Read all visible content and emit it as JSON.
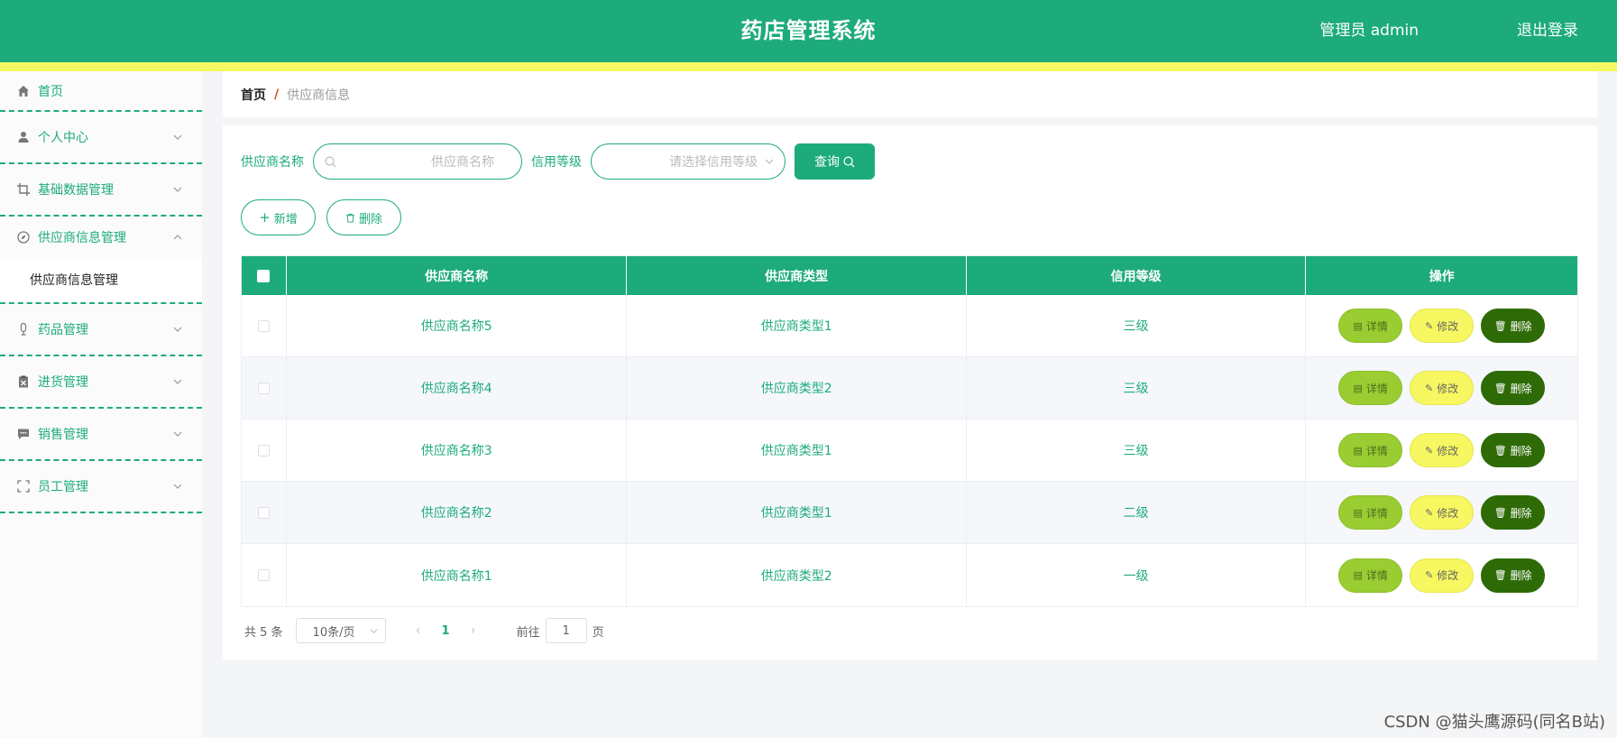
{
  "header": {
    "title": "药店管理系统",
    "user": "管理员 admin",
    "logout": "退出登录"
  },
  "sidebar": {
    "items": [
      {
        "label": "首页",
        "icon": "home-icon"
      },
      {
        "label": "个人中心",
        "icon": "user-icon"
      },
      {
        "label": "基础数据管理",
        "icon": "crop-icon"
      },
      {
        "label": "供应商信息管理",
        "icon": "compass-icon",
        "open": true,
        "children": [
          "供应商信息管理"
        ]
      },
      {
        "label": "药品管理",
        "icon": "microphone-icon"
      },
      {
        "label": "进货管理",
        "icon": "clipboard-icon"
      },
      {
        "label": "销售管理",
        "icon": "message-icon"
      },
      {
        "label": "员工管理",
        "icon": "fullscreen-icon"
      }
    ]
  },
  "breadcrumb": {
    "home": "首页",
    "separator": "/",
    "current": "供应商信息"
  },
  "search": {
    "name_label": "供应商名称",
    "name_placeholder": "供应商名称",
    "level_label": "信用等级",
    "level_placeholder": "请选择信用等级",
    "query_button": "查询"
  },
  "actions": {
    "add": "新增",
    "delete": "删除"
  },
  "table": {
    "headers": [
      "供应商名称",
      "供应商类型",
      "信用等级",
      "操作"
    ],
    "rows": [
      {
        "name": "供应商名称5",
        "type": "供应商类型1",
        "level": "三级"
      },
      {
        "name": "供应商名称4",
        "type": "供应商类型2",
        "level": "三级"
      },
      {
        "name": "供应商名称3",
        "type": "供应商类型1",
        "level": "三级"
      },
      {
        "name": "供应商名称2",
        "type": "供应商类型1",
        "level": "二级"
      },
      {
        "name": "供应商名称1",
        "type": "供应商类型2",
        "level": "一级"
      }
    ],
    "row_actions": {
      "detail": "详情",
      "edit": "修改",
      "delete": "删除"
    }
  },
  "pagination": {
    "total": "共 5 条",
    "page_size": "10条/页",
    "current_page": "1",
    "goto_prefix": "前往",
    "goto_value": "1",
    "goto_suffix": "页"
  },
  "watermark": "CSDN @猫头鹰源码(同名B站)",
  "colors": {
    "primary": "#1dab7c",
    "accent_yellow": "#f4f962",
    "detail_button": "#9acd32",
    "edit_button": "#f7f761",
    "delete_button": "#2e6b07"
  }
}
